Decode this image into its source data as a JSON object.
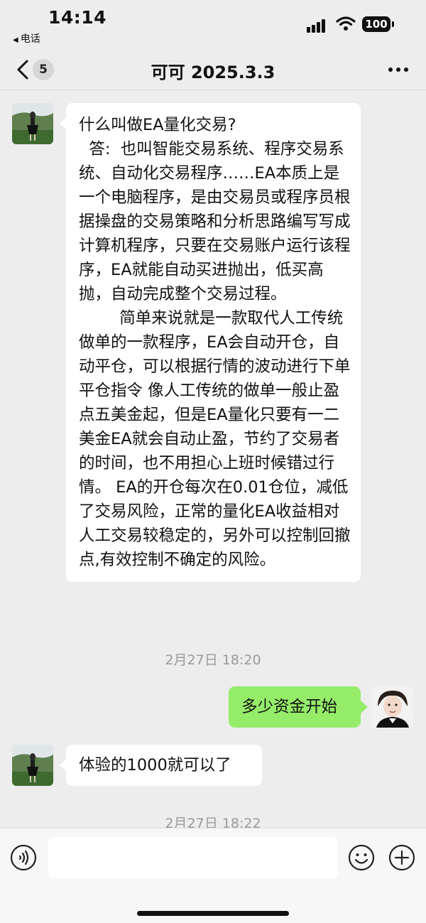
{
  "status_bar": {
    "time": "14:14",
    "back_app": "电话",
    "battery": "100"
  },
  "header": {
    "unread_count": "5",
    "title": "可可 2025.3.3"
  },
  "messages": [
    {
      "side": "incoming",
      "text": "什么叫做EA量化交易?\n  答:  也叫智能交易系统、程序交易系统、自动化交易程序……EA本质上是一个电脑程序，是由交易员或程序员根据操盘的交易策略和分析思路编写写成计算机程序，只要在交易账户运行该程序，EA就能自动买进抛出，低买高抛，自动完成整个交易过程。\n        简单来说就是一款取代人工传统做单的一款程序，EA会自动开仓，自动平仓，可以根据行情的波动进行下单平仓指令 像人工传统的做单一般止盈点五美金起，但是EA量化只要有一二美金EA就会自动止盈，节约了交易者的时间，也不用担心上班时候错过行情。 EA的开仓每次在0.01仓位，减低了交易风险，正常的量化EA收益相对人工交易较稳定的，另外可以控制回撤点,有效控制不确定的风险。"
    },
    {
      "side": "timestamp",
      "text": "2月27日 18:20"
    },
    {
      "side": "outgoing",
      "text": "多少资金开始"
    },
    {
      "side": "incoming",
      "text": "体验的1000就可以了"
    },
    {
      "side": "timestamp",
      "text": "2月27日 18:22"
    }
  ],
  "colors": {
    "background": "#ededed",
    "incoming_bubble": "#ffffff",
    "outgoing_bubble": "#95ec69",
    "timestamp": "#9a9a9a"
  },
  "icons": {
    "header_back": "chevron-left-icon",
    "header_more": "more-dots-icon",
    "voice": "voice-icon",
    "emoji": "emoji-icon",
    "plus": "plus-icon"
  },
  "input": {
    "placeholder": ""
  }
}
